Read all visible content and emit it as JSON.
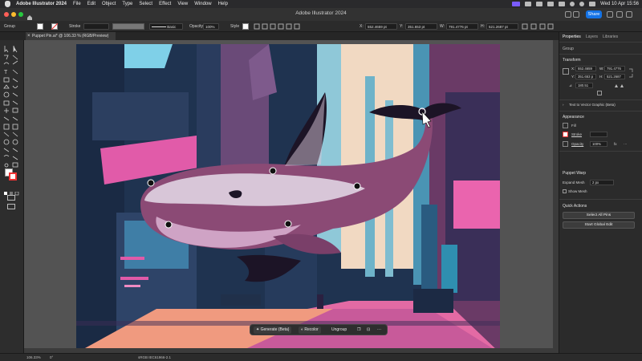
{
  "menubar": {
    "items": [
      "Adobe Illustrator 2024",
      "File",
      "Edit",
      "Object",
      "Type",
      "Select",
      "Effect",
      "View",
      "Window",
      "Help"
    ],
    "clock": "Wed 10 Apr  15:56"
  },
  "titlebar": {
    "title": "Adobe Illustrator 2024",
    "share_label": "Share"
  },
  "controlbar": {
    "selection_label": "Group",
    "stroke_label": "Stroke",
    "brush_label": "Basic",
    "opacity_label": "Opacity",
    "opacity_value": "100%",
    "style_label": "Style",
    "x_value": "552.4659 pt",
    "y_value": "351.653 pt",
    "w_value": "791.4776 pt",
    "h_value": "521.2687 pt"
  },
  "document": {
    "tab_label": "Puppet Pin.ai* @ 106.33 % (RGB/Preview)"
  },
  "panel": {
    "tabs": [
      "Properties",
      "Layers",
      "Libraries"
    ],
    "selection": "Group",
    "transform_header": "Transform",
    "x": "552.4659",
    "w": "791.4776",
    "y": "351.653 p",
    "h": "521.2687",
    "rotate": "180.51",
    "text_to_vector": "Text to Vector Graphic (Beta)",
    "appearance_header": "Appearance",
    "fill_label": "Fill",
    "stroke_label": "Stroke",
    "opacity_label": "Opacity",
    "opacity_value": "100%",
    "puppet_header": "Puppet Warp",
    "expand_mesh_label": "Expand Mesh",
    "expand_mesh_value": "2 px",
    "show_mesh_label": "Show Mesh",
    "quick_actions_header": "Quick Actions",
    "select_all_pins": "Select All Pins",
    "start_global_edit": "Start Global Edit"
  },
  "contextbar": {
    "generate": "Generate (Beta)",
    "recolor": "Recolor",
    "ungroup": "Ungroup"
  },
  "statusbar": {
    "zoom": "106.33%",
    "rotation": "0°",
    "color_mode": "sRGB IEC61966-2.1"
  },
  "colors": {
    "accent": "#1473e6",
    "whale_body": "#8b4a75",
    "whale_belly": "#cfa3c5",
    "artwork_pink": "#e05aa8",
    "artwork_teal": "#3aa8c8"
  }
}
